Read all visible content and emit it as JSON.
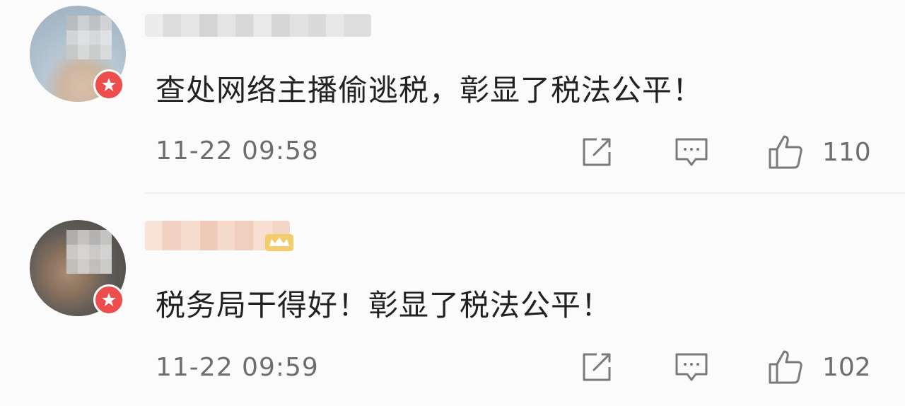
{
  "colors": {
    "background": "#fbfbfb",
    "text": "#222222",
    "meta_text": "#6d6d6d",
    "badge_red": "#ef4d4d",
    "vip_gold": "#f3cc6c"
  },
  "comments": [
    {
      "text": "查处网络主播偷逃税，彰显了税法公平！",
      "timestamp": "11-22 09:58",
      "likes": "110",
      "icons": [
        "avatar",
        "verified-badge-icon",
        "share-icon",
        "reply-icon",
        "like-icon"
      ]
    },
    {
      "text": "税务局干得好！彰显了税法公平！",
      "timestamp": "11-22 09:59",
      "likes": "102",
      "icons": [
        "avatar",
        "verified-badge-icon",
        "vip-icon",
        "share-icon",
        "reply-icon",
        "like-icon"
      ]
    }
  ]
}
